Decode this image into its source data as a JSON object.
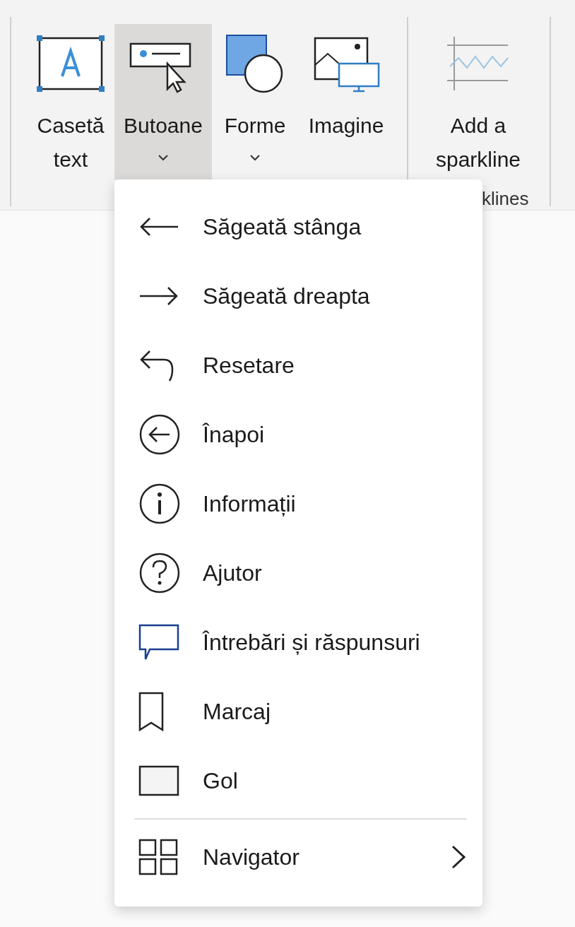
{
  "ribbon": {
    "groups": [
      {
        "buttons": [
          {
            "kind": "text-box",
            "label": "Casetă text",
            "dropdown": false,
            "selected": false
          },
          {
            "kind": "buttons",
            "label": "Butoane",
            "dropdown": true,
            "selected": true
          },
          {
            "kind": "shapes",
            "label": "Forme",
            "dropdown": true,
            "selected": false
          },
          {
            "kind": "image",
            "label": "Imagine",
            "dropdown": false,
            "selected": false
          }
        ]
      },
      {
        "label": "klines",
        "buttons": [
          {
            "kind": "sparkline",
            "label": "Add a sparkline",
            "dropdown": false,
            "selected": false
          }
        ]
      }
    ]
  },
  "menu": {
    "items": [
      {
        "kind": "arrow-left",
        "label": "Săgeată stânga"
      },
      {
        "kind": "arrow-right",
        "label": "Săgeată dreapta"
      },
      {
        "kind": "reset",
        "label": "Resetare"
      },
      {
        "kind": "back",
        "label": "Înapoi"
      },
      {
        "kind": "info",
        "label": "Informații"
      },
      {
        "kind": "help",
        "label": "Ajutor"
      },
      {
        "kind": "qa",
        "label": "Întrebări și răspunsuri"
      },
      {
        "kind": "bookmark",
        "label": "Marcaj"
      },
      {
        "kind": "blank",
        "label": "Gol"
      },
      {
        "kind": "separator"
      },
      {
        "kind": "navigator",
        "label": "Navigator",
        "submenu": true
      }
    ]
  }
}
